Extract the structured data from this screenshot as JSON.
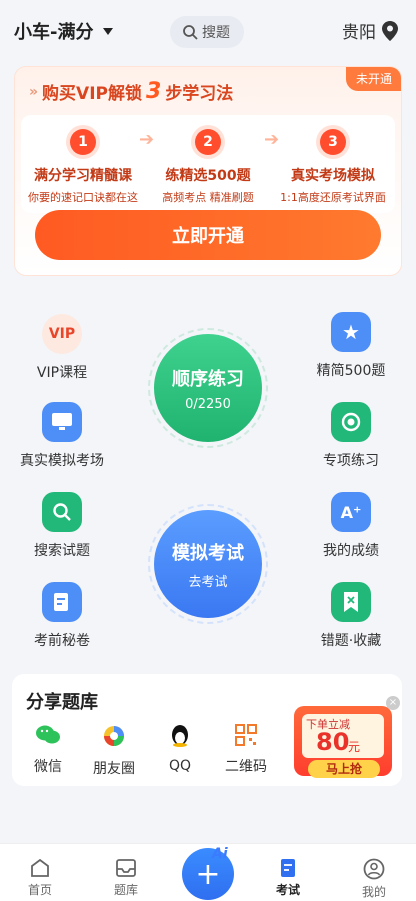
{
  "header": {
    "car_label": "小车-满分",
    "search_label": "搜题",
    "city": "贵阳"
  },
  "vip": {
    "title_prefix": "购买VIP解锁",
    "title_num": "3",
    "title_suffix": "步学习法",
    "badge": "未开通",
    "steps": [
      {
        "num": "1",
        "title": "满分学习精髓课",
        "sub": "你要的速记口诀都在这"
      },
      {
        "num": "2",
        "title": "练精选500题",
        "sub": "高频考点 精准刷题"
      },
      {
        "num": "3",
        "title": "真实考场模拟",
        "sub": "1:1高度还原考试界面"
      }
    ],
    "button": "立即开通"
  },
  "menu": {
    "left": [
      "VIP课程",
      "真实模拟考场",
      "搜索试题",
      "考前秘卷"
    ],
    "right": [
      "精简500题",
      "专项练习",
      "我的成绩",
      "错题·收藏"
    ],
    "vip_icon_text": "VIP",
    "practice": {
      "title": "顺序练习",
      "progress": "0/2250"
    },
    "exam": {
      "title": "模拟考试",
      "sub": "去考试"
    }
  },
  "share": {
    "title": "分享题库",
    "items": [
      "微信",
      "朋友圈",
      "QQ",
      "二维码"
    ],
    "promo": {
      "top": "下单立减",
      "amount": "80",
      "unit": "元",
      "button": "马上抢"
    }
  },
  "tabs": [
    "首页",
    "题库",
    "考试",
    "我的"
  ],
  "fab": {
    "ai": "Ai"
  }
}
